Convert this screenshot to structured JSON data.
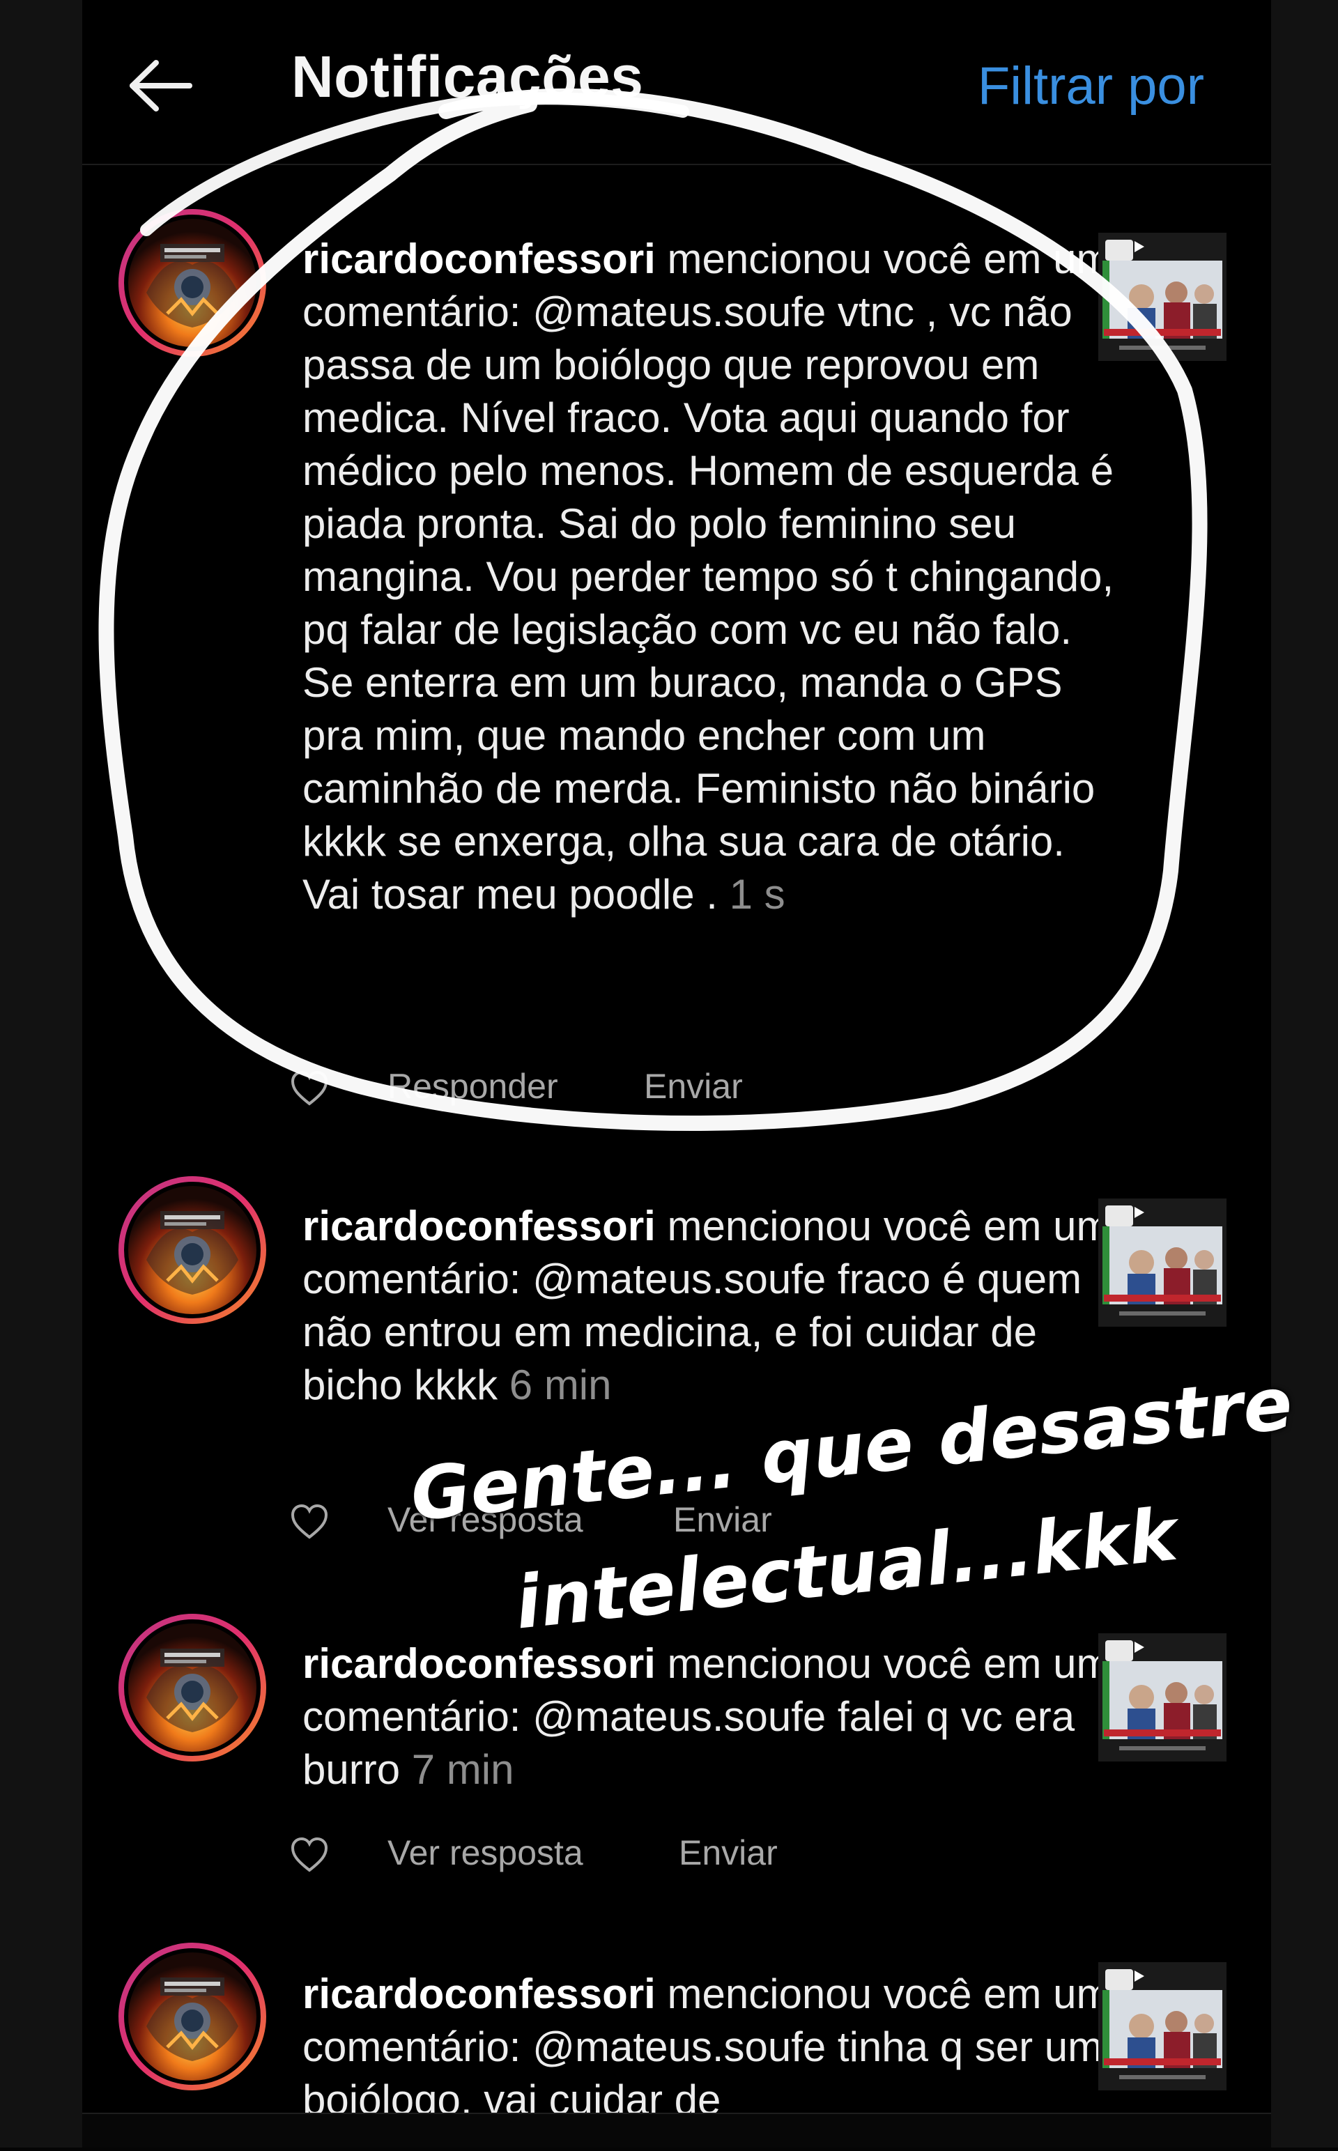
{
  "header": {
    "title": "Notificações",
    "filter_label": "Filtrar por"
  },
  "notifications": [
    {
      "username": "ricardoconfessori",
      "message": " mencionou você em um comentário: @mateus.soufe vtnc , vc não passa de um  boiólogo que reprovou em medica. Nível fraco. Vota aqui quando for médico pelo menos. Homem de esquerda é piada pronta. Sai do polo feminino seu mangina. Vou perder tempo só t chingando, pq falar de legislação com vc eu não falo. Se enterra em um buraco, manda o GPS pra mim, que mando encher com um caminhão de merda. Feministo não binário kkkk se enxerga, olha sua cara de otário. Vai tosar meu poodle .",
      "time": "1 s",
      "reply_label": "Responder",
      "send_label": "Enviar"
    },
    {
      "username": "ricardoconfessori",
      "message": " mencionou você em um comentário: @mateus.soufe fraco é quem não entrou em medicina, e foi cuidar de bicho kkkk",
      "time": "6 min",
      "reply_label": "Ver resposta",
      "send_label": "Enviar"
    },
    {
      "username": "ricardoconfessori",
      "message": " mencionou você em um comentário: @mateus.soufe falei q vc era burro",
      "time": "7 min",
      "reply_label": "Ver resposta",
      "send_label": "Enviar"
    },
    {
      "username": "ricardoconfessori",
      "message": " mencionou você em um comentário: @mateus.soufe tinha q ser um boiólogo, vai cuidar de",
      "time": ""
    }
  ],
  "overlay": {
    "caption_line1": "Gente... que desastre",
    "caption_line2": "intelectual...kkk",
    "circle_color": "#ffffff"
  },
  "icons": {
    "back": "arrow-left-icon",
    "like": "heart-outline-icon"
  },
  "colors": {
    "accent": "#3a8fe0",
    "background": "#000000",
    "avatar_ring": "#c13584"
  }
}
